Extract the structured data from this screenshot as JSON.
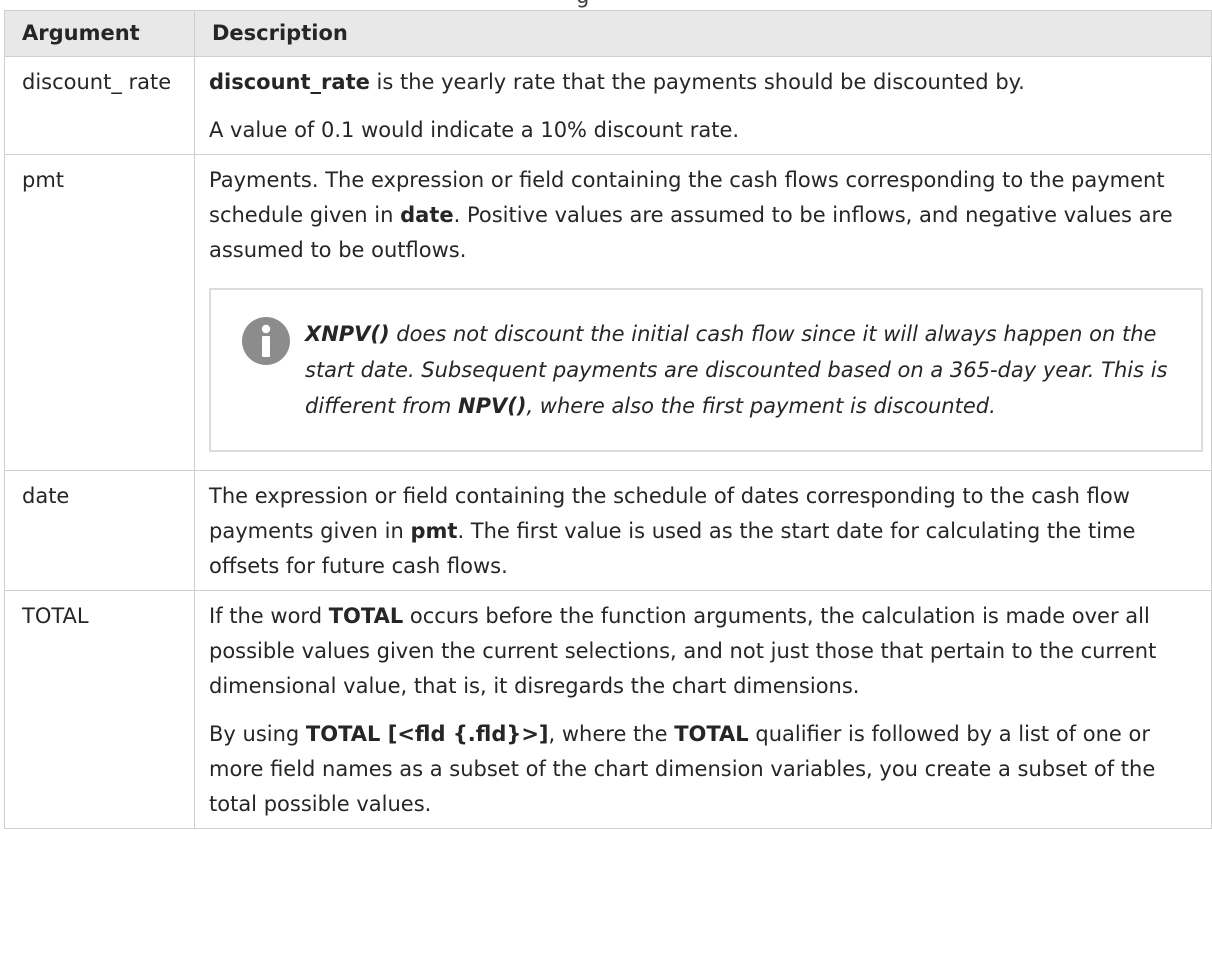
{
  "caption_fragment": "g",
  "table": {
    "headers": {
      "argument": "Argument",
      "description": "Description"
    },
    "discount_rate": {
      "arg": "discount_ rate",
      "p1_bold": "discount_rate",
      "p1_rest": " is the yearly rate that the payments should be discounted by.",
      "p2": "A value of 0.1 would indicate a 10% discount rate."
    },
    "pmt": {
      "arg": "pmt",
      "p1_a": "Payments. The expression or field containing the cash flows corresponding to the payment schedule given in ",
      "p1_bold": "date",
      "p1_b": ". Positive values are assumed to be inflows, and negative values are assumed to be outflows.",
      "note": {
        "icon": "info-icon",
        "bold1": "XNPV()",
        "text1": " does not discount the initial cash flow since it will always happen on the start date. Subsequent payments are discounted based on a 365-day year. This is different from ",
        "bold2": "NPV()",
        "text2": ", where also the first payment is discounted."
      }
    },
    "date": {
      "arg": "date",
      "p1_a": "The expression or field containing the schedule of dates corresponding to the cash flow payments given in ",
      "p1_bold": "pmt",
      "p1_b": ". The first value is used as the start date for calculating the time offsets for future cash flows."
    },
    "total": {
      "arg": "TOTAL",
      "p1_a": "If the word ",
      "p1_bold": "TOTAL",
      "p1_b": " occurs before the function arguments, the calculation is made over all possible values given the current selections, and not just those that pertain to the current dimensional value, that is, it disregards the chart dimensions.",
      "p2_a": "By using ",
      "p2_bold1": "TOTAL [<fld {.fld}>]",
      "p2_b": ", where the ",
      "p2_bold2": "TOTAL",
      "p2_c": " qualifier is followed by a list of one or more field names as a subset of the chart dimension variables, you create a subset of the total possible values."
    }
  },
  "colors": {
    "header_bg": "#e8e8e8",
    "border": "#cfcfcf",
    "icon": "#8c8c8c"
  }
}
